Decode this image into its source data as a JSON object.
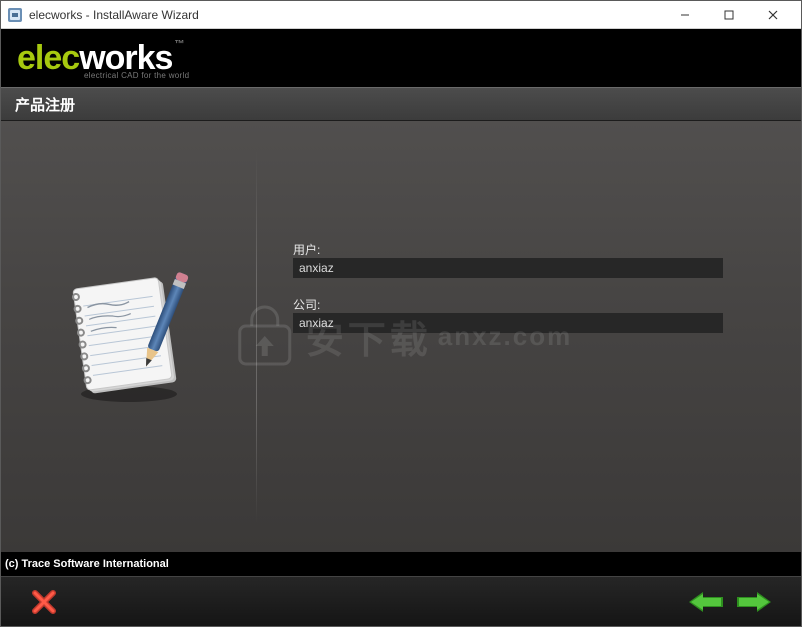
{
  "window": {
    "title": "elecworks - InstallAware Wizard"
  },
  "logo": {
    "part1": "elec",
    "part2": "works",
    "tm": "™",
    "tagline": "electrical CAD for the world"
  },
  "step": {
    "title": "产品注册"
  },
  "form": {
    "user_label": "用户:",
    "user_value": "anxiaz",
    "company_label": "公司:",
    "company_value": "anxiaz"
  },
  "watermark": {
    "cn": "安下载",
    "en": "anxz.com"
  },
  "copyright": "(c) Trace Software International",
  "icons": {
    "minimize": "minimize-icon",
    "maximize": "maximize-icon",
    "close": "close-icon",
    "cancel": "cancel-x-icon",
    "back": "arrow-left-icon",
    "next": "arrow-right-icon",
    "notepad": "notepad-pencil-icon",
    "app": "app-icon"
  },
  "colors": {
    "accent": "#a7c90f",
    "nav_green": "#3fae29"
  }
}
